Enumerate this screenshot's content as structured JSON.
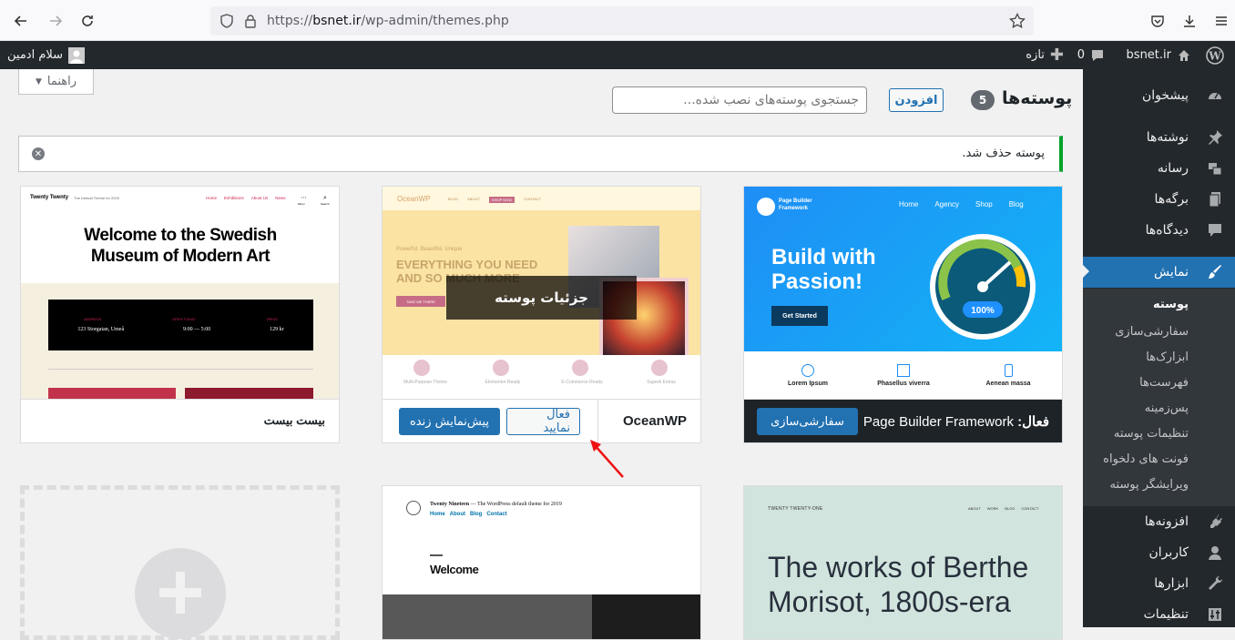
{
  "browser": {
    "url_prefix": "https://",
    "url_domain": "bsnet.ir",
    "url_path": "/wp-admin/themes.php"
  },
  "adminbar": {
    "site_name": "bsnet.ir",
    "comments_count": "0",
    "new_label": "تازه",
    "greeting": "سلام ادمین"
  },
  "sidebar": {
    "items": [
      {
        "label": "پیشخوان",
        "icon": "dashboard-icon"
      },
      {
        "label": "نوشته‌ها",
        "icon": "pin-icon"
      },
      {
        "label": "رسانه",
        "icon": "media-icon"
      },
      {
        "label": "برگه‌ها",
        "icon": "pages-icon"
      },
      {
        "label": "دیدگاه‌ها",
        "icon": "comments-icon"
      },
      {
        "label": "نمایش",
        "icon": "appearance-icon"
      },
      {
        "label": "افزونه‌ها",
        "icon": "plugins-icon"
      },
      {
        "label": "کاربران",
        "icon": "users-icon"
      },
      {
        "label": "ابزارها",
        "icon": "tools-icon"
      },
      {
        "label": "تنظیمات",
        "icon": "settings-icon"
      }
    ],
    "submenu": [
      "پوسته",
      "سفارشی‌سازی",
      "ابزارک‌ها",
      "فهرست‌ها",
      "پس‌زمینه",
      "تنظیمات پوسته",
      "فونت های دلخواه",
      "ویرایشگر پوسته"
    ]
  },
  "header": {
    "title": "پوسته‌ها",
    "count": "5",
    "add_label": "افزودن",
    "search_placeholder": "جستجوی پوسته‌های نصب شده...",
    "help_label": "راهنما"
  },
  "notice": {
    "text": "پوسته حذف شد."
  },
  "themes": {
    "active": {
      "prefix": "فعال:",
      "name": "Page Builder Framework",
      "customize_label": "سفارشی‌سازی",
      "shot": {
        "nav": [
          "Home",
          "Agency",
          "Shop",
          "Blog"
        ],
        "logo": "Page Builder Framework",
        "headline1": "Build with",
        "headline2": "Passion!",
        "cta": "Get Started",
        "gauge": "100%",
        "features": [
          "Lorem Ipsum",
          "Phasellus viverra",
          "Aenean massa"
        ]
      }
    },
    "oceanwp": {
      "name": "OceanWP",
      "activate_label": "فعال نمایید",
      "preview_label": "پیش‌نمایش زنده",
      "details_label": "جزئیات پوسته",
      "shot": {
        "logo": "OceanWP",
        "nav": [
          "BLOG",
          "ABOUT",
          "SHOP NOW",
          "CONTACT"
        ],
        "tag": "Powerful. Beautiful. Unique",
        "headline1": "EVERYTHING YOU NEED",
        "headline2": "AND SO MUCH MORE",
        "btn": "TAKE ME THERE",
        "features": [
          "Multi-Purpose Theme",
          "Elementor Ready",
          "E-Commerce Ready",
          "Superb Extras"
        ]
      }
    },
    "twentytwenty": {
      "name": "بیست بیست",
      "shot": {
        "brand": "Twenty Twenty",
        "tagline": "The Default Theme for 2020",
        "nav": [
          "Home",
          "Exhibitions",
          "About Us",
          "News"
        ],
        "menu": "Menu",
        "search": "Search",
        "headline": "Welcome to the Swedish Museum of Modern Art",
        "info_labels": [
          "ADDRESS",
          "OPEN TODAY",
          "PRICE"
        ],
        "info_values": [
          "123 Storgatan, Umeå",
          "9:00 — 5:00",
          "129 kr"
        ]
      }
    },
    "twentynineteen": {
      "shot": {
        "brand": "Twenty Nineteen",
        "tagline": "— The WordPress default theme for 2019",
        "nav": [
          "Home",
          "About",
          "Blog",
          "Contact"
        ],
        "welcome": "Welcome"
      }
    },
    "twentytwentyone": {
      "shot": {
        "brand": "TWENTY TWENTY-ONE",
        "nav": [
          "ABOUT",
          "WORK",
          "BLOG",
          "CONTACT"
        ],
        "headline": "The works of Berthe Morisot, 1800s-era"
      }
    }
  },
  "colors": {
    "accent": "#2271b1",
    "adminbar": "#23282d",
    "notice_success": "#00a32a"
  }
}
